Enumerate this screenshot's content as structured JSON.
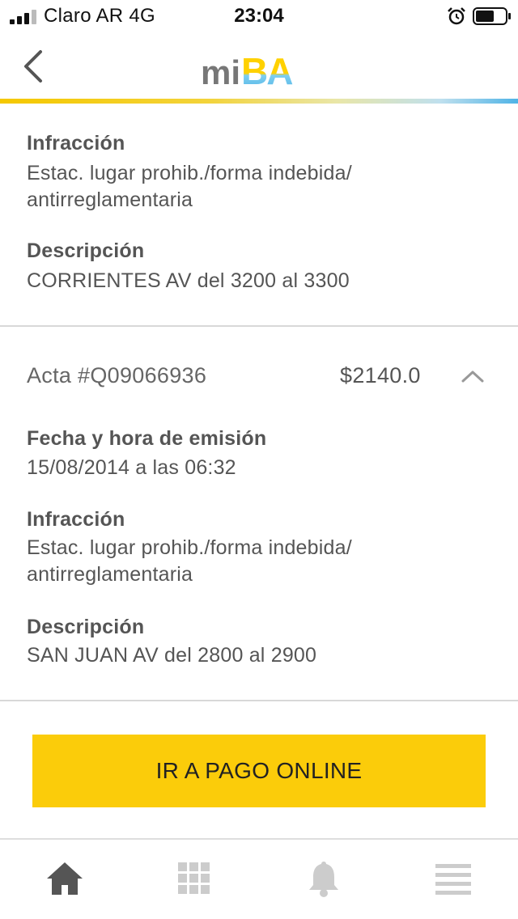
{
  "status_bar": {
    "carrier": "Claro AR",
    "network": "4G",
    "time": "23:04"
  },
  "header": {
    "logo_text": "miBA",
    "back_icon": "chevron-left-icon"
  },
  "infraction_block_1": {
    "infraccion_label": "Infracción",
    "infraccion_line1": "Estac. lugar prohib./forma indebida/",
    "infraccion_line2": "antirreglamentaria",
    "descripcion_label": "Descripción",
    "descripcion_value": "CORRIENTES AV del 3200 al 3300"
  },
  "acta": {
    "number": "Acta #Q09066936",
    "amount": "$2140.0",
    "fecha_label": "Fecha y hora de emisión",
    "fecha_value": "15/08/2014 a las 06:32",
    "infraccion_label": "Infracción",
    "infraccion_line1": "Estac. lugar prohib./forma indebida/",
    "infraccion_line2": "antirreglamentaria",
    "descripcion_label": "Descripción",
    "descripcion_value": "SAN JUAN AV del 2800 al 2900"
  },
  "pay_button_label": "IR A PAGO ONLINE",
  "tab_bar": {
    "items": [
      "home-icon",
      "grid-icon",
      "bell-icon",
      "menu-icon"
    ],
    "active": "home-icon"
  },
  "colors": {
    "accent": "#fbcc0a",
    "text": "#555555",
    "tab_active": "#555555",
    "tab_inactive": "#cccccc"
  }
}
